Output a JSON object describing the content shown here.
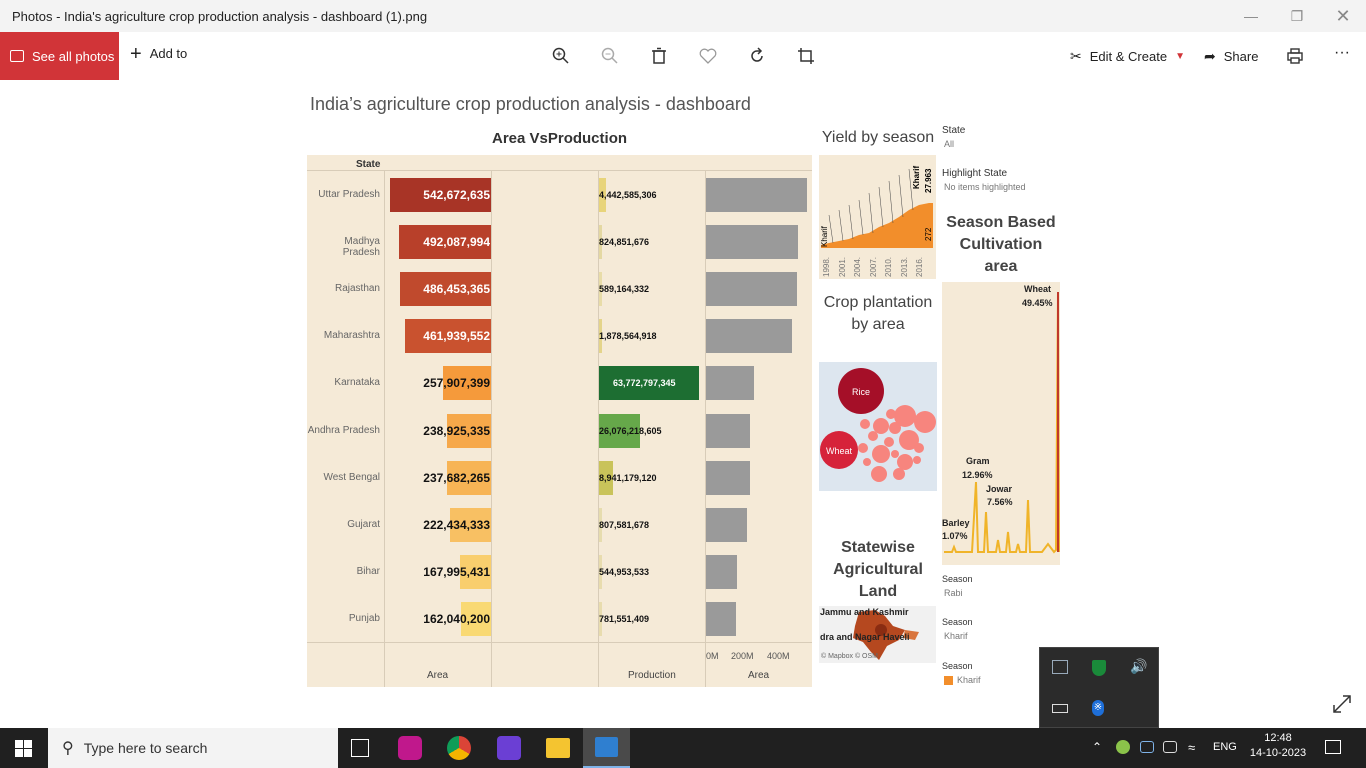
{
  "window": {
    "title": "Photos - India's agriculture crop production analysis - dashboard (1).png"
  },
  "toolbar": {
    "see_all_photos": "See all photos",
    "add_to": "Add to",
    "edit_create": "Edit & Create",
    "share": "Share",
    "more": "···"
  },
  "dashboard": {
    "title": "India’s agriculture crop production analysis - dashboard",
    "area_vs_production": {
      "title": "Area VsProduction",
      "state_header": "State",
      "col_area": "Area",
      "col_production": "Production",
      "col_area2": "Area",
      "axis_ticks": [
        "0M",
        "200M",
        "400M"
      ]
    },
    "yield_title": "Yield by season",
    "yield_labels": {
      "kharif_top": "Kharif",
      "kharif_bottom": "Kharif",
      "val1": "27.963",
      "val2": "272",
      "years": [
        "1998.",
        "2001.",
        "2004.",
        "2007.",
        "2010.",
        "2013.",
        "2016."
      ]
    },
    "crop_plantation_title": "Crop plantation by area",
    "bubbles": {
      "rice": "Rice",
      "wheat": "Wheat"
    },
    "statewise_title": "Statewise Agricultural Land",
    "map_labels": {
      "jk": "Jammu and Kashmir",
      "dnh": "dra and Nagar Haveli",
      "credit": "© Mapbox © OSM"
    },
    "season_based_title": "Season Based Cultivation area",
    "season_area_labels": {
      "wheat": "Wheat",
      "wheat_pct": "49.45%",
      "gram": "Gram",
      "gram_pct": "12.96%",
      "jowar": "Jowar",
      "jowar_pct": "7.56%",
      "barley": "Barley",
      "barley_pct": "1.07%"
    },
    "filters": {
      "state_label": "State",
      "state_value": "All",
      "highlight_label": "Highlight State",
      "highlight_value": "No items highlighted",
      "season1_label": "Season",
      "season1_value": "Rabi",
      "season2_label": "Season",
      "season2_value": "Kharif",
      "season3_label": "Season",
      "season3_value": "Kharif"
    }
  },
  "chart_data": {
    "type": "bar",
    "title": "Area VsProduction",
    "categories": [
      "Uttar Pradesh",
      "Madhya Pradesh",
      "Rajasthan",
      "Maharashtra",
      "Karnataka",
      "Andhra Pradesh",
      "West Bengal",
      "Gujarat",
      "Bihar",
      "Punjab"
    ],
    "series": [
      {
        "name": "Area",
        "values": [
          542672635,
          492087994,
          486453365,
          461939552,
          257907399,
          238925335,
          237682265,
          222434333,
          167995431,
          162040200
        ],
        "labels": [
          "542,672,635",
          "492,087,994",
          "486,453,365",
          "461,939,552",
          "257,907,399",
          "238,925,335",
          "237,682,265",
          "222,434,333",
          "167,995,431",
          "162,040,200"
        ]
      },
      {
        "name": "Production",
        "values": [
          4442585306,
          824851676,
          589164332,
          1878564918,
          63772797345,
          26076218605,
          8941179120,
          807581678,
          544953533,
          781551409
        ],
        "labels": [
          "4,442,585,306",
          "824,851,676",
          "589,164,332",
          "1,878,564,918",
          "63,772,797,345",
          "26,076,218,605",
          "8,941,179,120",
          "807,581,678",
          "544,953,533",
          "781,551,409"
        ]
      }
    ]
  },
  "taskbar": {
    "search_placeholder": "Type here to search",
    "lang": "ENG",
    "time": "12:48",
    "date": "14-10-2023"
  }
}
